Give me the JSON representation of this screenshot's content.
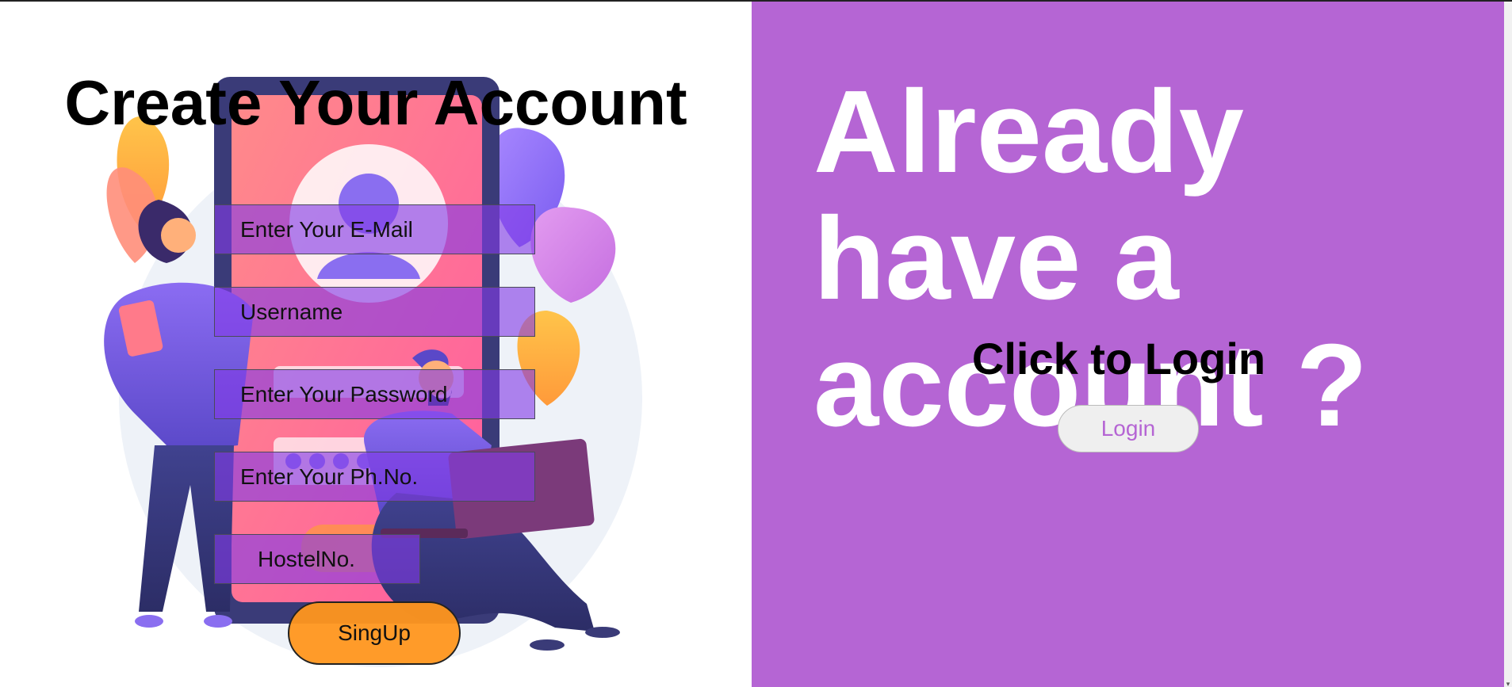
{
  "signup": {
    "title": "Create Your Account",
    "fields": {
      "email_placeholder": "Enter Your E-Mail",
      "username_placeholder": "Username",
      "password_placeholder": "Enter Your Password",
      "phone_placeholder": "Enter Your Ph.No.",
      "hostel_placeholder": "HostelNo."
    },
    "submit_label": "SingUp"
  },
  "login_panel": {
    "heading": "Already have a account ?",
    "subheading": "Click to Login",
    "button_label": "Login"
  },
  "colors": {
    "panel_purple": "#b565d4",
    "field_fill": "#823ce6",
    "signup_orange": "#ff961e",
    "login_text": "#b565d4"
  },
  "icons": {
    "illustration": "signup-illustration"
  }
}
